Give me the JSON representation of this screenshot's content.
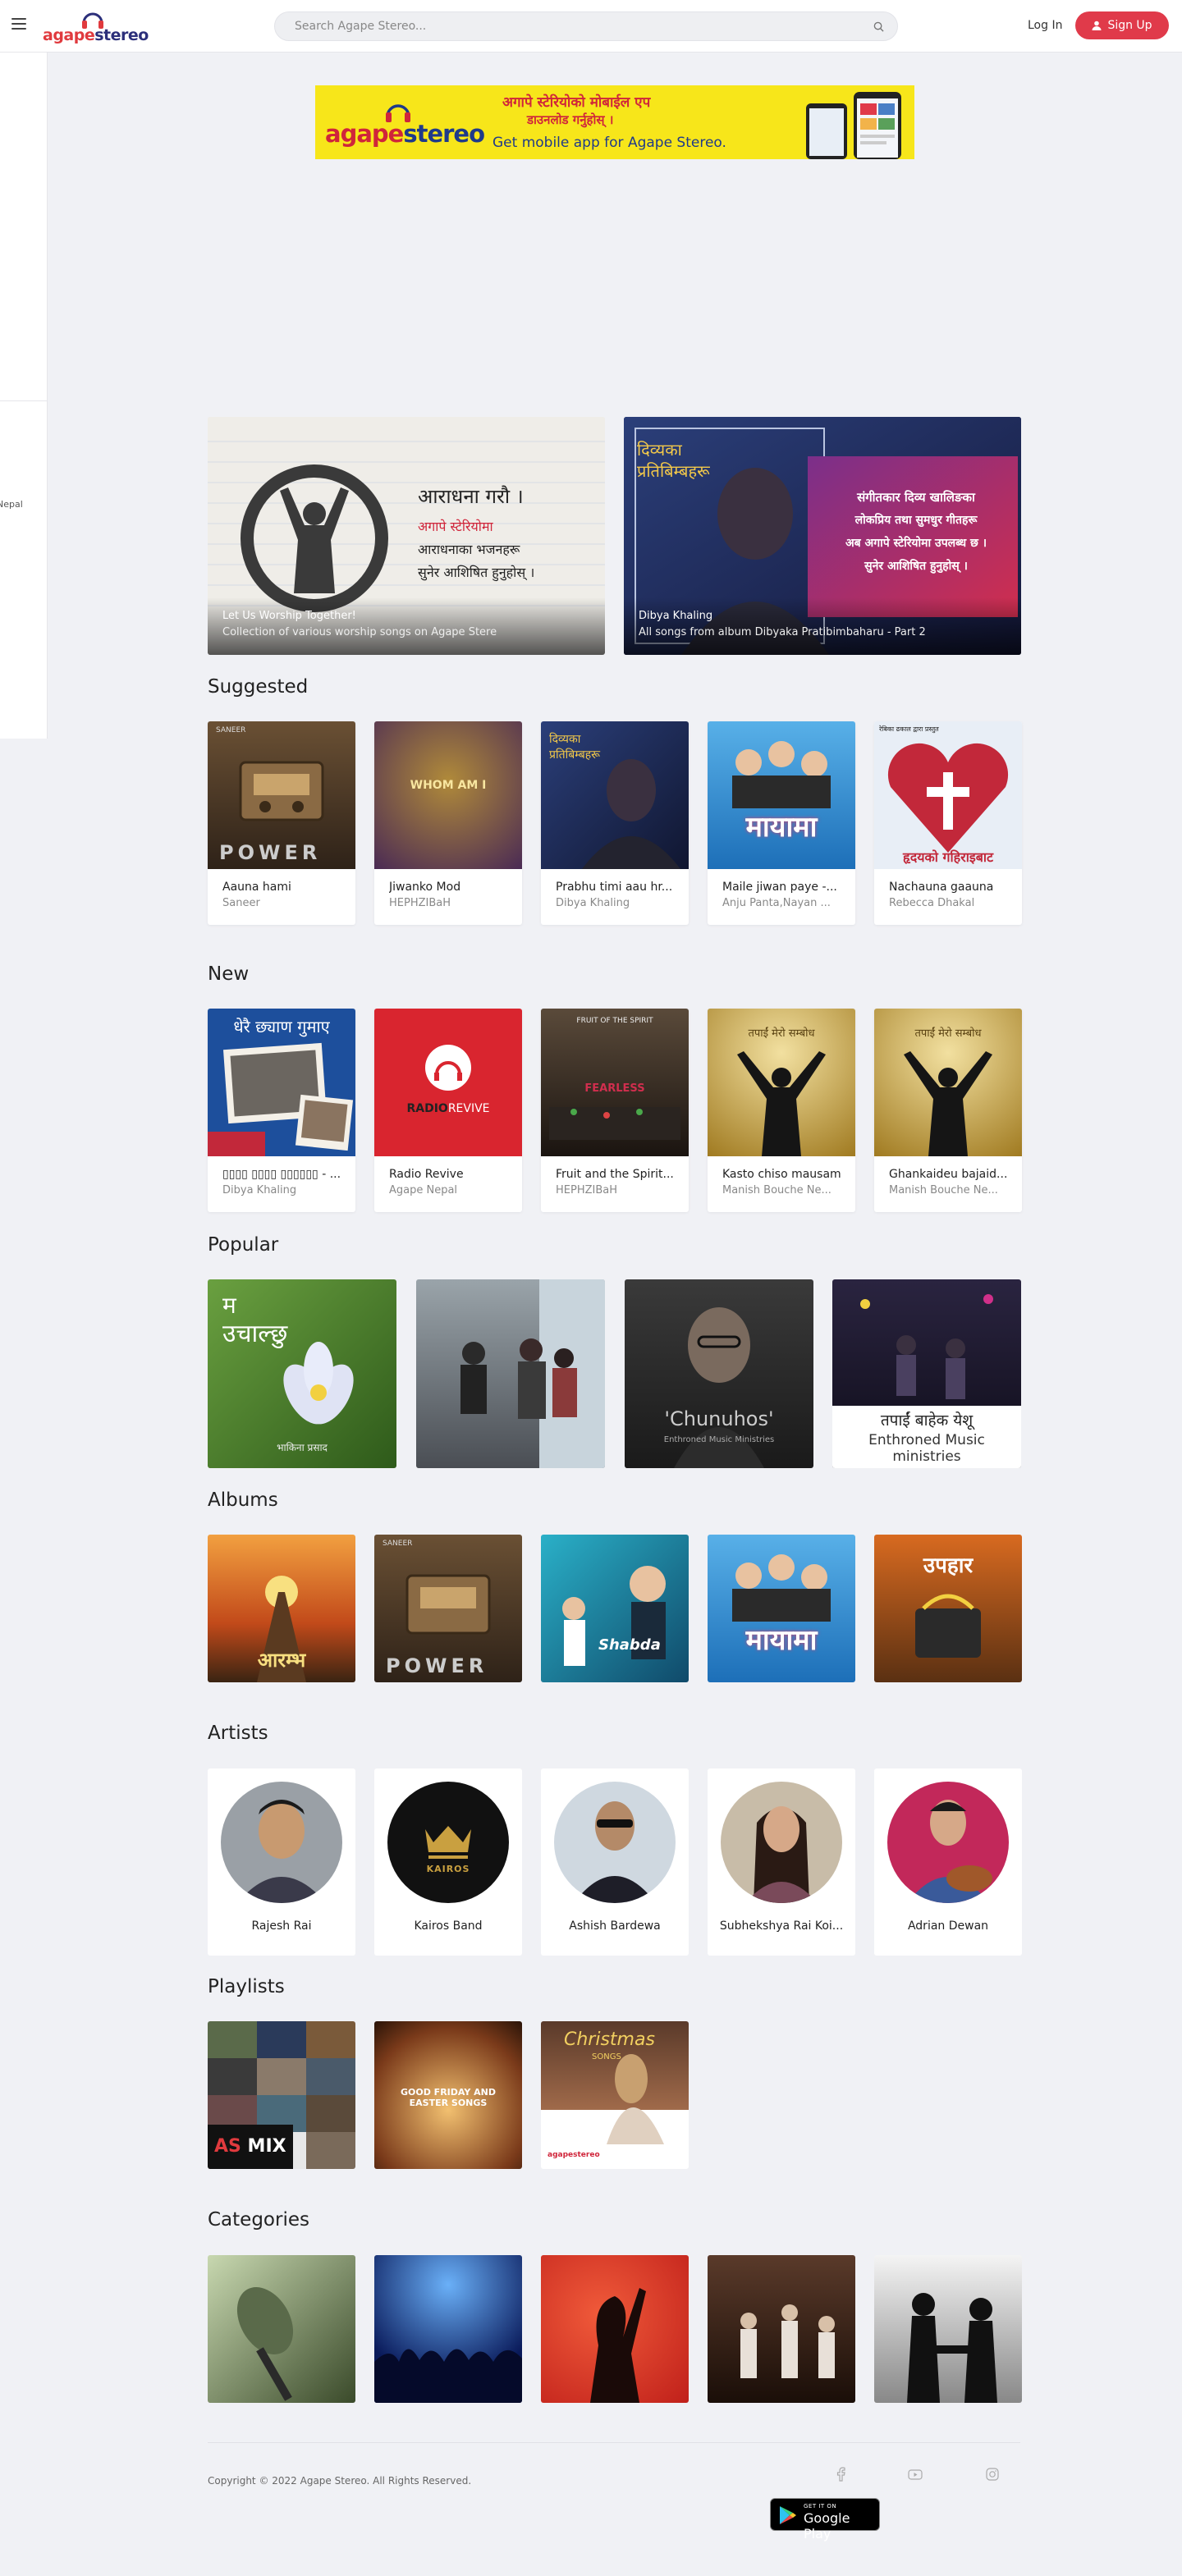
{
  "header": {
    "logo_a": "agape",
    "logo_s": "stereo",
    "search_placeholder": "Search Agape Stereo...",
    "login_label": "Log In",
    "signup_label": "Sign Up"
  },
  "sidebar": {
    "partial_text": "Nepal"
  },
  "ad": {
    "line1": "अगापे स्टेरियोको मोबाईल एप",
    "line2": "डाउनलोड गर्नुहोस् ।",
    "line3": "Get mobile app for Agape Stereo.",
    "logo_a": "agape",
    "logo_s": "stereo",
    "bg": "#f7e61a"
  },
  "featured": [
    {
      "title": "Let Us Worship Together!",
      "subtitle": "Collection of various worship songs on Agape Stere",
      "art_lines": [
        "आराधना गरौ ।",
        "अगापे स्टेरियोमा",
        "आराधनाका भजनहरू",
        "सुनेर आशिषित हुनुहोस् ।"
      ]
    },
    {
      "title": "Dibya Khaling",
      "subtitle": "All songs from album Dibyaka Pratibimbaharu - Part 2",
      "art_lines": [
        "दिव्यका",
        "प्रतिबिम्बहरू",
        "संगीतकार दिव्य खालिङका",
        "लोकप्रिय तथा सुमधुर गीतहरू",
        "अब अगापे स्टेरियोमा उपलब्ध छ ।",
        "सुनेर आशिषित हुनुहोस् ।"
      ]
    }
  ],
  "sections": {
    "suggested": "Suggested",
    "new": "New",
    "popular": "Popular",
    "albums": "Albums",
    "artists": "Artists",
    "playlists": "Playlists",
    "categories": "Categories"
  },
  "suggested": [
    {
      "title": "Aauna hami",
      "subtitle": "Saneer"
    },
    {
      "title": "Jiwanko Mod",
      "subtitle": "HEPHZIBaH"
    },
    {
      "title": "Prabhu timi aau hr...",
      "subtitle": "Dibya Khaling"
    },
    {
      "title": "Maile jiwan paye -...",
      "subtitle": "Anju Panta,Nayan ..."
    },
    {
      "title": "Nachauna gaauna",
      "subtitle": "Rebecca Dhakal"
    }
  ],
  "new": [
    {
      "title": "▯▯▯▯ ▯▯▯▯ ▯▯▯▯▯▯ - ...",
      "subtitle": "Dibya Khaling"
    },
    {
      "title": "Radio Revive",
      "subtitle": "Agape Nepal"
    },
    {
      "title": "Fruit and the Spirit...",
      "subtitle": "HEPHZIBaH"
    },
    {
      "title": "Kasto chiso mausam",
      "subtitle": "Manish Bouche Ne..."
    },
    {
      "title": "Ghankaideu bajaid...",
      "subtitle": "Manish Bouche Ne..."
    }
  ],
  "new_art": {
    "n1": "धेरै छ्याण गुमाए",
    "n2_a": "RADIO",
    "n2_b": "REVIVE",
    "n3": "FRUIT OF THE SPIRIT",
    "n3_b": "FEARLESS",
    "n4": "तपाईं मेरो सम्बोध",
    "n5": "तपाईं मेरो सम्बोध"
  },
  "suggested_art": {
    "s1_top": "SANEER",
    "s1_bottom": "POWER",
    "s2": "WHOM AM I",
    "s3": "दिव्यका प्रतिबिम्बहरू",
    "s4": "मायामा",
    "s5_top": "रेबिका ढकाल द्वारा प्रस्तुत",
    "s5_bottom": "हृदयको गहिराइबाट"
  },
  "popular_art": {
    "p1_top": "म",
    "p1_mid": "उचाल्छु",
    "p1_bottom": "भाकिना प्रसाद",
    "p3_a": "'Chunuhos'",
    "p3_b": "Enthroned Music Ministries",
    "p4_a": "तपाईं बाहेक येशू",
    "p4_b": "Enthroned Music ministries"
  },
  "albums_art": {
    "a1": "आरम्भ",
    "a2_top": "SANEER",
    "a2_bottom": "POWER",
    "a3": "Shabda",
    "a4": "मायामा",
    "a5": "उपहार"
  },
  "artists": [
    {
      "name": "Rajesh Rai"
    },
    {
      "name": "Kairos Band"
    },
    {
      "name": "Ashish Bardewa"
    },
    {
      "name": "Subhekshya Rai Koi..."
    },
    {
      "name": "Adrian Dewan"
    }
  ],
  "artist_art": {
    "kairos": "KAIROS"
  },
  "playlists_art": {
    "pl1_a": "AS",
    "pl1_b": "MIX",
    "pl2": "GOOD FRIDAY AND EASTER SONGS",
    "pl3_a": "Christmas",
    "pl3_b": "SONGS",
    "pl3_logo": "agapestereo"
  },
  "footer": {
    "copyright": "Copyright © 2022 Agape Stereo. All Rights Reserved.",
    "gplay_top": "GET IT ON",
    "gplay_bottom": "Google Play"
  },
  "colors": {
    "accent": "#e03a4a",
    "brand_blue": "#2c2f7a",
    "brand_red": "#e03a3e"
  }
}
